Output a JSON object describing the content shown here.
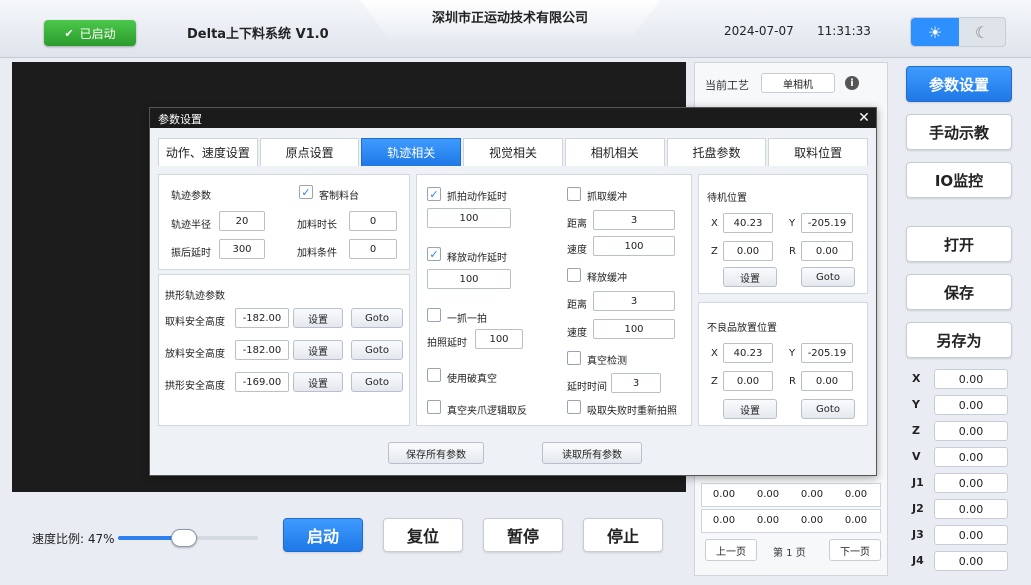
{
  "header": {
    "status_label": "已启动",
    "app_title": "Delta上下料系统  V1.0",
    "company": "深圳市正运动技术有限公司",
    "date": "2024-07-07",
    "time": "11:31:33",
    "sun_icon": "☀",
    "moon_icon": "☾"
  },
  "info_panel": {
    "process_label": "当前工艺",
    "process_value": "单相机",
    "info_icon": "i",
    "coords": [
      [
        "0.00",
        "0.00",
        "0.00",
        "0.00"
      ],
      [
        "0.00",
        "0.00",
        "0.00",
        "0.00"
      ]
    ],
    "prev_page": "上一页",
    "page_text": "第 1 页",
    "next_page": "下一页"
  },
  "side_buttons": [
    "参数设置",
    "手动示教",
    "IO监控",
    "打开",
    "保存",
    "另存为"
  ],
  "axes": [
    {
      "label": "X",
      "value": "0.00"
    },
    {
      "label": "Y",
      "value": "0.00"
    },
    {
      "label": "Z",
      "value": "0.00"
    },
    {
      "label": "V",
      "value": "0.00"
    },
    {
      "label": "J1",
      "value": "0.00"
    },
    {
      "label": "J2",
      "value": "0.00"
    },
    {
      "label": "J3",
      "value": "0.00"
    },
    {
      "label": "J4",
      "value": "0.00"
    }
  ],
  "speed": {
    "label": "速度比例: 47%",
    "fraction": 0.47
  },
  "bottom_buttons": [
    "启动",
    "复位",
    "暂停",
    "停止"
  ],
  "dialog": {
    "title": "参数设置",
    "close_icon": "✕",
    "tabs": [
      "动作、速度设置",
      "原点设置",
      "轨迹相关",
      "视觉相关",
      "相机相关",
      "托盘参数",
      "取料位置"
    ],
    "active_tab": 2,
    "track": {
      "title": "轨迹参数",
      "custom_material": "客制料台",
      "radius_label": "轨迹半径",
      "radius": "20",
      "feed_time_label": "加料时长",
      "feed_time": "0",
      "swing_delay_label": "振后延时",
      "swing_delay": "300",
      "feed_cond_label": "加料条件",
      "feed_cond": "0"
    },
    "arch": {
      "title": "拱形轨迹参数",
      "rows": [
        {
          "label": "取料安全高度",
          "value": "-182.00"
        },
        {
          "label": "放料安全高度",
          "value": "-182.00"
        },
        {
          "label": "拱形安全高度",
          "value": "-169.00"
        }
      ],
      "set_label": "设置",
      "goto_label": "Goto"
    },
    "middle": {
      "grab_delay_label": "抓拍动作延时",
      "grab_delay": "100",
      "release_delay_label": "释放动作延时",
      "release_delay": "100",
      "one_shot_label": "一抓一拍",
      "photo_delay_label": "拍照延时",
      "photo_delay": "100",
      "break_vacuum_label": "使用破真空",
      "vacuum_invert_label": "真空夹爪逻辑取反",
      "grab_buffer_label": "抓取缓冲",
      "dist_label": "距离",
      "speed_label": "速度",
      "grab_dist": "3",
      "grab_speed": "100",
      "release_buffer_label": "释放缓冲",
      "release_dist": "3",
      "release_speed": "100",
      "vacuum_detect_label": "真空检测",
      "delay_time_label": "延时时间",
      "delay_time": "3",
      "retake_label": "吸取失败时重新拍照"
    },
    "standby": {
      "title": "待机位置",
      "x": "40.23",
      "y": "-205.19",
      "z": "0.00",
      "r": "0.00"
    },
    "reject": {
      "title": "不良品放置位置",
      "x": "40.23",
      "y": "-205.19",
      "z": "0.00",
      "r": "0.00"
    },
    "axis_letters": {
      "x": "X",
      "y": "Y",
      "z": "Z",
      "r": "R"
    },
    "save_all": "保存所有参数",
    "load_all": "读取所有参数"
  },
  "colors": {
    "accent": "#2e7ff0",
    "status_green": "#2a9b2c"
  }
}
